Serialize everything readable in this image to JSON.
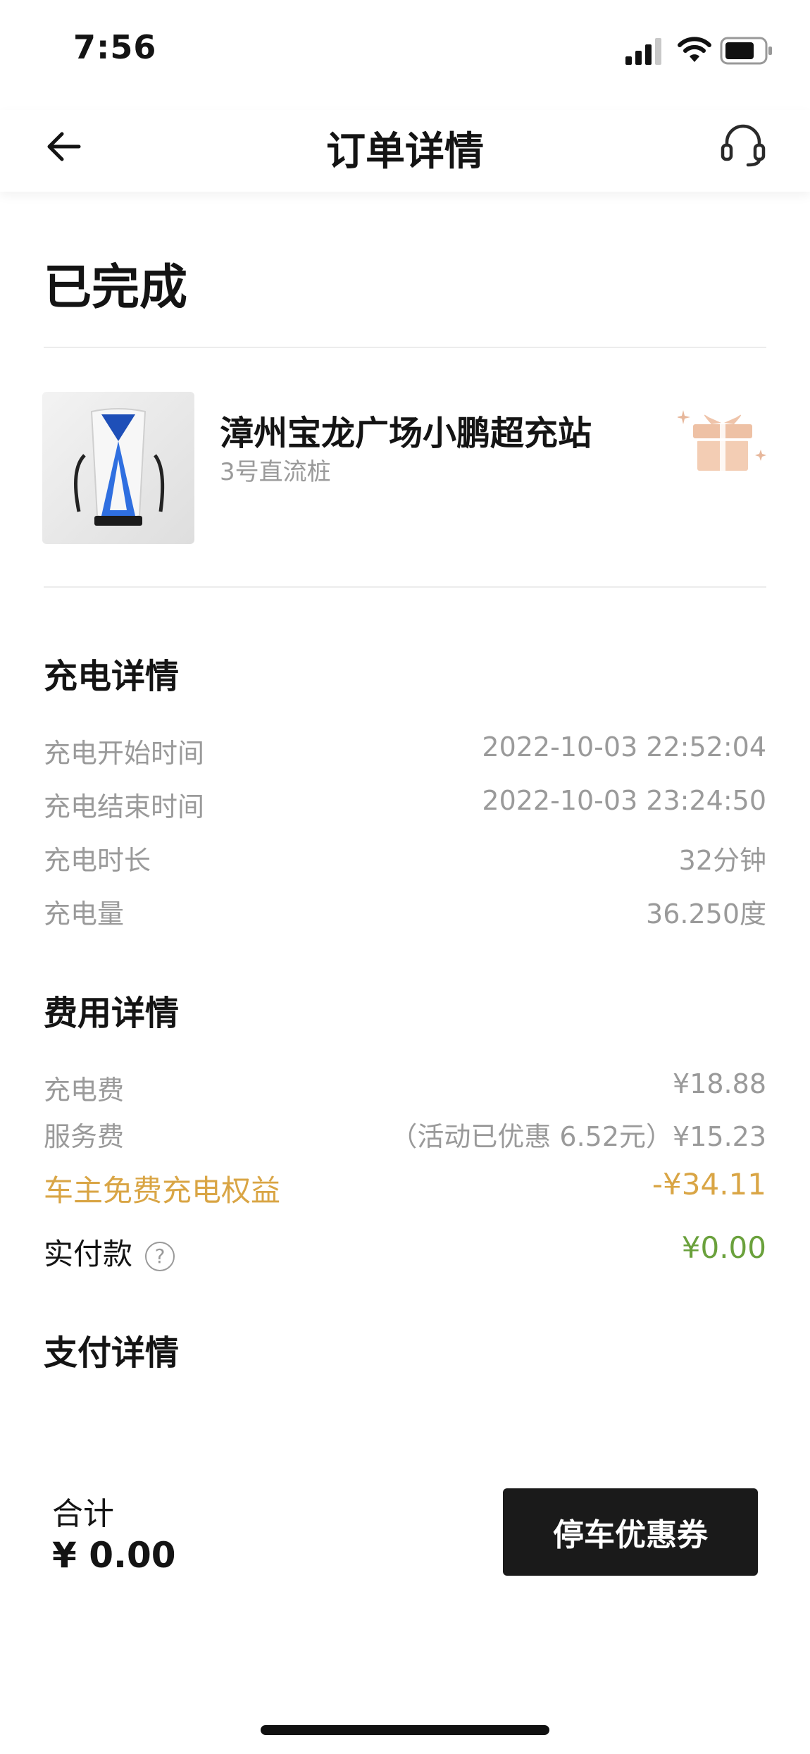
{
  "status_bar": {
    "time": "7:56"
  },
  "nav": {
    "title": "订单详情"
  },
  "order": {
    "status": "已完成"
  },
  "station": {
    "name": "漳州宝龙广场小鹏超充站",
    "pile": "3号直流桩"
  },
  "charging": {
    "title": "充电详情",
    "rows": [
      {
        "label": "充电开始时间",
        "value": "2022-10-03 22:52:04"
      },
      {
        "label": "充电结束时间",
        "value": "2022-10-03 23:24:50"
      },
      {
        "label": "充电时长",
        "value": "32分钟"
      },
      {
        "label": "充电量",
        "value": "36.250度"
      }
    ]
  },
  "fees": {
    "title": "费用详情",
    "rows": [
      {
        "label": "充电费",
        "value": "¥18.88"
      },
      {
        "label": "服务费",
        "value": "（活动已优惠 6.52元）¥15.23"
      }
    ],
    "benefit": {
      "label": "车主免费充电权益",
      "value": "-¥34.11"
    },
    "paid": {
      "label": "实付款",
      "value": "¥0.00",
      "help": "?"
    }
  },
  "payment": {
    "title": "支付详情"
  },
  "footer": {
    "total_label": "合计",
    "total_value": "¥ 0.00",
    "coupon_button": "停车优惠券"
  },
  "colors": {
    "accent_gold": "#d9a545",
    "paid_green": "#6aa13c",
    "button_dark": "#1a1a1a"
  }
}
